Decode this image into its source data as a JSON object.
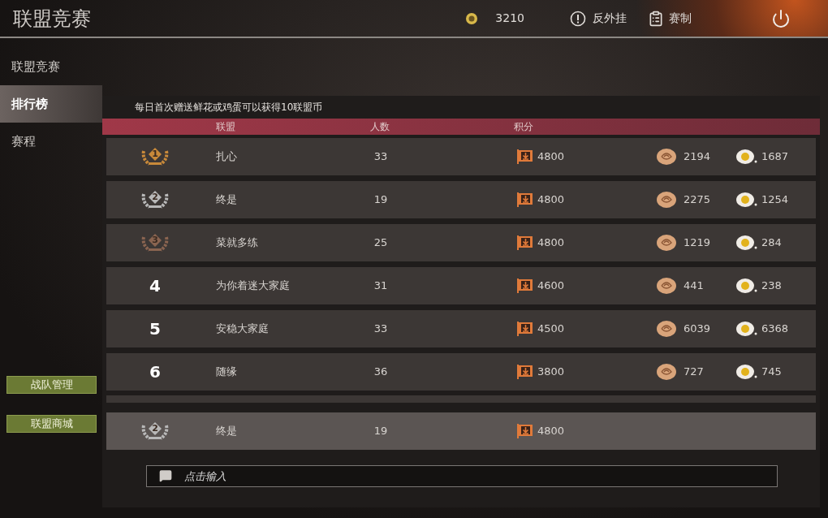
{
  "header": {
    "title": "联盟竞赛",
    "currency": "3210",
    "anti_cheat": "反外挂",
    "rules": "赛制"
  },
  "sidebar": {
    "items": [
      {
        "label": "联盟竞赛",
        "selected": false
      },
      {
        "label": "排行榜",
        "selected": true
      },
      {
        "label": "赛程",
        "selected": false
      }
    ],
    "buttons": [
      "战队管理",
      "联盟商城"
    ]
  },
  "notice": "每日首次赠送鲜花或鸡蛋可以获得10联盟币",
  "table": {
    "columns": [
      "联盟",
      "人数",
      "积分"
    ],
    "rows": [
      {
        "rank": "1",
        "kind": "medal",
        "color": "#c8893a",
        "name": "扎心",
        "members": "33",
        "score": "4800",
        "flowers": "2194",
        "eggs": "1687"
      },
      {
        "rank": "2",
        "kind": "medal",
        "color": "#b8b8b8",
        "name": "终是",
        "members": "19",
        "score": "4800",
        "flowers": "2275",
        "eggs": "1254"
      },
      {
        "rank": "3",
        "kind": "medal",
        "color": "#8a6450",
        "name": "菜就多练",
        "members": "25",
        "score": "4800",
        "flowers": "1219",
        "eggs": "284"
      },
      {
        "rank": "4",
        "kind": "number",
        "name": "为你着迷大家庭",
        "members": "31",
        "score": "4600",
        "flowers": "441",
        "eggs": "238"
      },
      {
        "rank": "5",
        "kind": "number",
        "name": "安稳大家庭",
        "members": "33",
        "score": "4500",
        "flowers": "6039",
        "eggs": "6368"
      },
      {
        "rank": "6",
        "kind": "number",
        "name": "随缘",
        "members": "36",
        "score": "3800",
        "flowers": "727",
        "eggs": "745"
      }
    ]
  },
  "own_entry": {
    "rank": "2",
    "kind": "medal",
    "color": "#b8b8b8",
    "name": "终是",
    "members": "19",
    "score": "4800"
  },
  "chat": {
    "placeholder": "点击输入"
  }
}
